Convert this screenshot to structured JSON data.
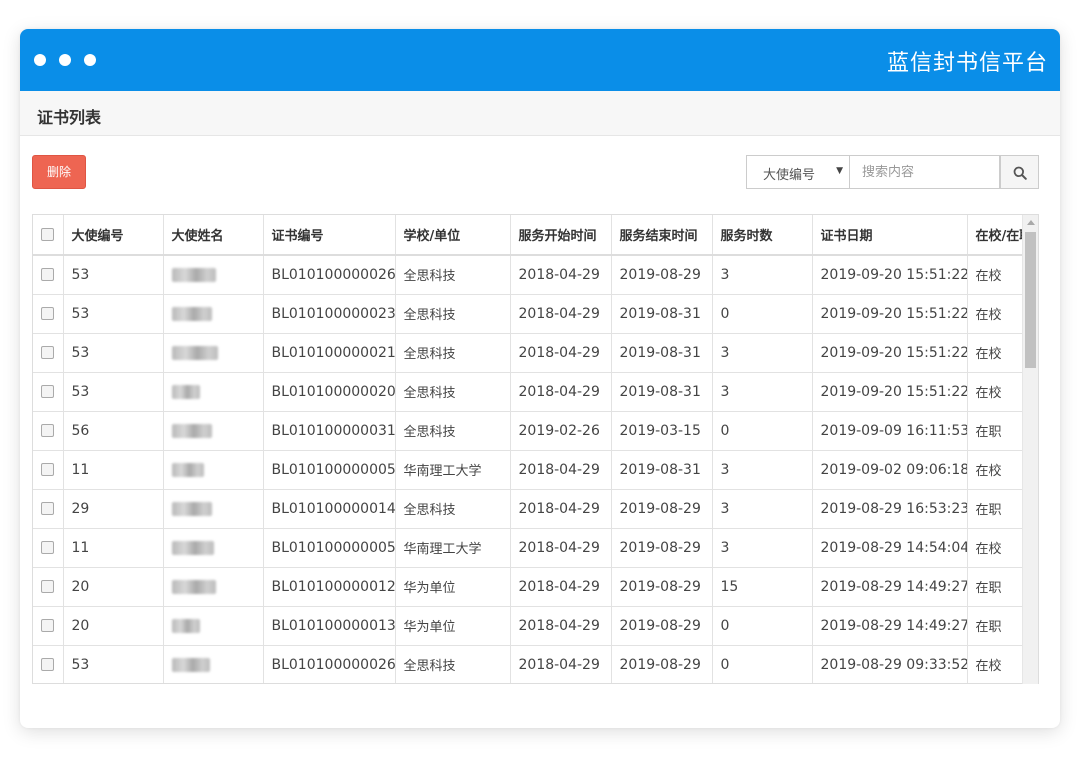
{
  "app": {
    "brand": "蓝信封书信平台"
  },
  "panel": {
    "title": "证书列表"
  },
  "toolbar": {
    "delete_label": "删除"
  },
  "search": {
    "field_selected": "大使编号",
    "placeholder": "搜索内容"
  },
  "table": {
    "headers": [
      "大使编号",
      "大使姓名",
      "证书编号",
      "学校/单位",
      "服务开始时间",
      "服务结束时间",
      "服务时数",
      "证书日期",
      "在校/在职"
    ],
    "rows": [
      {
        "id": "53",
        "cert": "BL010100000026",
        "org": "全思科技",
        "start": "2018-04-29",
        "end": "2019-08-29",
        "hours": "3",
        "date": "2019-09-20 15:51:22",
        "status": "在校"
      },
      {
        "id": "53",
        "cert": "BL010100000023",
        "org": "全思科技",
        "start": "2018-04-29",
        "end": "2019-08-31",
        "hours": "0",
        "date": "2019-09-20 15:51:22",
        "status": "在校"
      },
      {
        "id": "53",
        "cert": "BL010100000021",
        "org": "全思科技",
        "start": "2018-04-29",
        "end": "2019-08-31",
        "hours": "3",
        "date": "2019-09-20 15:51:22",
        "status": "在校"
      },
      {
        "id": "53",
        "cert": "BL010100000020",
        "org": "全思科技",
        "start": "2018-04-29",
        "end": "2019-08-31",
        "hours": "3",
        "date": "2019-09-20 15:51:22",
        "status": "在校"
      },
      {
        "id": "56",
        "cert": "BL010100000031",
        "org": "全思科技",
        "start": "2019-02-26",
        "end": "2019-03-15",
        "hours": "0",
        "date": "2019-09-09 16:11:53",
        "status": "在职"
      },
      {
        "id": "11",
        "cert": "BL010100000005",
        "org": "华南理工大学",
        "start": "2018-04-29",
        "end": "2019-08-31",
        "hours": "3",
        "date": "2019-09-02 09:06:18",
        "status": "在校"
      },
      {
        "id": "29",
        "cert": "BL010100000014",
        "org": "全思科技",
        "start": "2018-04-29",
        "end": "2019-08-29",
        "hours": "3",
        "date": "2019-08-29 16:53:23",
        "status": "在职"
      },
      {
        "id": "11",
        "cert": "BL010100000005",
        "org": "华南理工大学",
        "start": "2018-04-29",
        "end": "2019-08-29",
        "hours": "3",
        "date": "2019-08-29 14:54:04",
        "status": "在校"
      },
      {
        "id": "20",
        "cert": "BL010100000012",
        "org": "华为单位",
        "start": "2018-04-29",
        "end": "2019-08-29",
        "hours": "15",
        "date": "2019-08-29 14:49:27",
        "status": "在职"
      },
      {
        "id": "20",
        "cert": "BL010100000013",
        "org": "华为单位",
        "start": "2018-04-29",
        "end": "2019-08-29",
        "hours": "0",
        "date": "2019-08-29 14:49:27",
        "status": "在职"
      },
      {
        "id": "53",
        "cert": "BL010100000026",
        "org": "全思科技",
        "start": "2018-04-29",
        "end": "2019-08-29",
        "hours": "0",
        "date": "2019-08-29 09:33:52",
        "status": "在校"
      }
    ]
  },
  "colors": {
    "header": "#0a8ee8",
    "danger": "#ee6552"
  },
  "icons": {
    "search": "search-icon",
    "select_caret": "caret-down-icon"
  }
}
